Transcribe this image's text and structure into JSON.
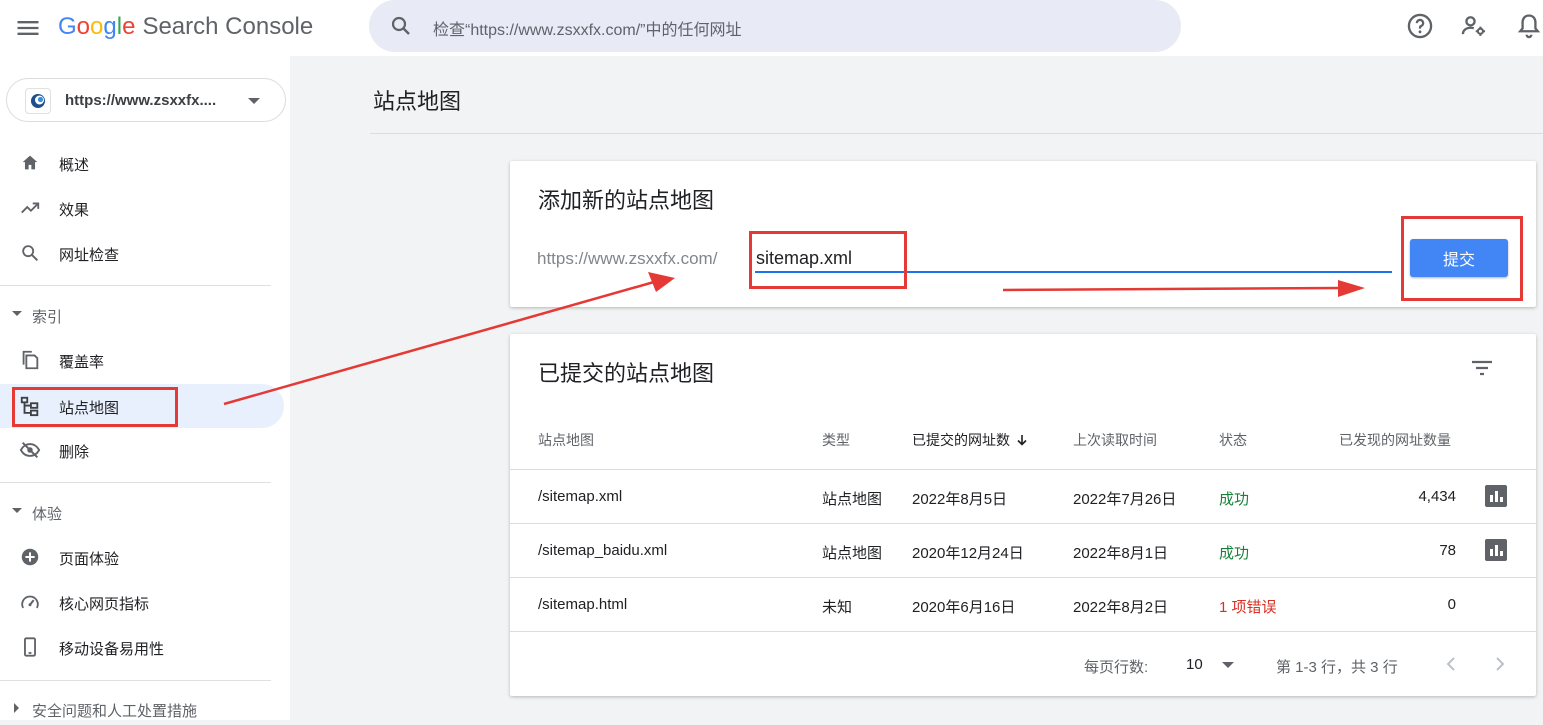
{
  "app": {
    "logo_letters": [
      "G",
      "o",
      "o",
      "g",
      "l",
      "e"
    ],
    "product": "Search Console"
  },
  "search": {
    "placeholder": "检查“https://www.zsxxfx.com/”中的任何网址"
  },
  "property": {
    "label": "https://www.zsxxfx...."
  },
  "nav": {
    "items": [
      {
        "label": "概述",
        "icon": "home-icon"
      },
      {
        "label": "效果",
        "icon": "trending-up-icon"
      },
      {
        "label": "网址检查",
        "icon": "search-icon"
      }
    ],
    "section_index": "索引",
    "index_items": [
      {
        "label": "覆盖率",
        "icon": "copy-icon"
      },
      {
        "label": "站点地图",
        "icon": "sitemap-icon",
        "active": true
      },
      {
        "label": "删除",
        "icon": "visibility-off-icon"
      }
    ],
    "section_experience": "体验",
    "experience_items": [
      {
        "label": "页面体验",
        "icon": "add-circle-icon"
      },
      {
        "label": "核心网页指标",
        "icon": "speed-gauge-icon"
      },
      {
        "label": "移动设备易用性",
        "icon": "phone-icon"
      }
    ],
    "section_security": "安全问题和人工处置措施"
  },
  "page": {
    "title": "站点地图"
  },
  "add_card": {
    "title": "添加新的站点地图",
    "url_prefix": "https://www.zsxxfx.com/",
    "input_value": "sitemap.xml",
    "submit_label": "提交"
  },
  "list_card": {
    "title": "已提交的站点地图",
    "columns": [
      "站点地图",
      "类型",
      "已提交的网址数",
      "上次读取时间",
      "状态",
      "已发现的网址数量"
    ],
    "rows": [
      {
        "sitemap": "/sitemap.xml",
        "type": "站点地图",
        "submitted": "2022年8月5日",
        "last_read": "2022年7月26日",
        "status": "成功",
        "status_kind": "ok",
        "discovered": "4,434"
      },
      {
        "sitemap": "/sitemap_baidu.xml",
        "type": "站点地图",
        "submitted": "2020年12月24日",
        "last_read": "2022年8月1日",
        "status": "成功",
        "status_kind": "ok",
        "discovered": "78"
      },
      {
        "sitemap": "/sitemap.html",
        "type": "未知",
        "submitted": "2020年6月16日",
        "last_read": "2022年8月2日",
        "status": "1 项错误",
        "status_kind": "error",
        "discovered": "0"
      }
    ],
    "rows_per_page_label": "每页行数:",
    "rows_per_page": "10",
    "range_label": "第 1-3 行，共 3 行"
  },
  "colors": {
    "accent": "#4285f4",
    "annotation": "#e53935",
    "success": "#188038",
    "error": "#d93025"
  }
}
